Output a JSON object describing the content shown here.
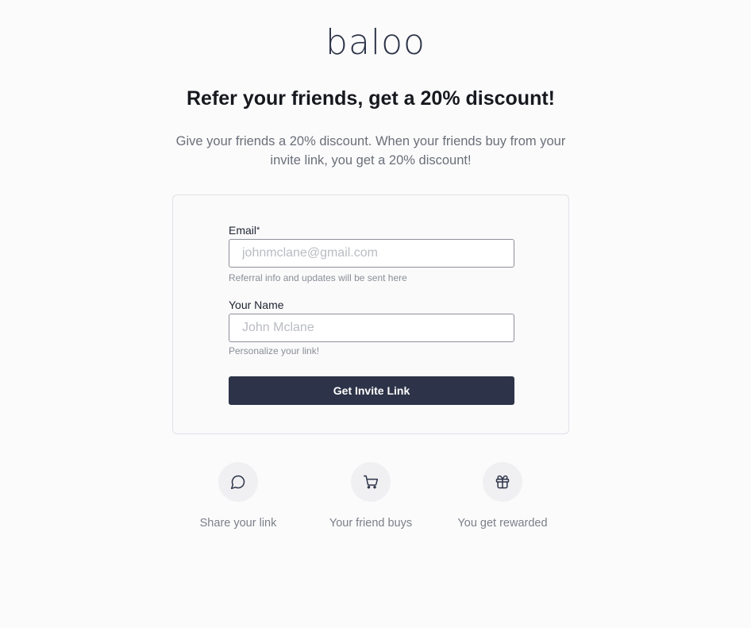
{
  "brand": {
    "logo_text": "baloo"
  },
  "headline": "Refer your friends, get a 20% discount!",
  "subtitle": "Give your friends a 20% discount. When your friends buy from your invite link, you get a 20% discount!",
  "form": {
    "email": {
      "label": "Email",
      "required_mark": "*",
      "placeholder": "johnmclane@gmail.com",
      "value": "",
      "hint": "Referral info and updates will be sent here"
    },
    "name": {
      "label": "Your Name",
      "placeholder": "John Mclane",
      "value": "",
      "hint": "Personalize your link!"
    },
    "submit_label": "Get Invite Link"
  },
  "steps": [
    {
      "icon": "chat-bubble-icon",
      "label": "Share your link"
    },
    {
      "icon": "shopping-cart-icon",
      "label": "Your friend buys"
    },
    {
      "icon": "gift-icon",
      "label": "You get rewarded"
    }
  ],
  "colors": {
    "background": "#fbfbfc",
    "button": "#2d3348",
    "logo": "#2c3347",
    "muted_text": "#6b6f78",
    "icon_circle": "#f0f0f2"
  }
}
